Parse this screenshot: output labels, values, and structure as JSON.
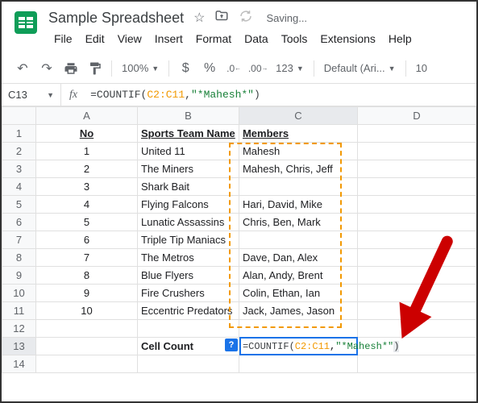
{
  "doc": {
    "title": "Sample Spreadsheet",
    "saving": "Saving..."
  },
  "menu": {
    "file": "File",
    "edit": "Edit",
    "view": "View",
    "insert": "Insert",
    "format": "Format",
    "data": "Data",
    "tools": "Tools",
    "extensions": "Extensions",
    "help": "Help"
  },
  "toolbar": {
    "zoom": "100%",
    "numfmt": "123",
    "font": "Default (Ari...",
    "fontsize": "10"
  },
  "cellref": "C13",
  "formula": {
    "fn": "=COUNTIF",
    "open": "(",
    "range": "C2:C11",
    "comma": ",",
    "str": "\"*Mahesh*\"",
    "close": ")"
  },
  "cols": {
    "A": "A",
    "B": "B",
    "C": "C",
    "D": "D"
  },
  "rows": [
    "1",
    "2",
    "3",
    "4",
    "5",
    "6",
    "7",
    "8",
    "9",
    "10",
    "11",
    "12",
    "13",
    "14"
  ],
  "headers": {
    "no": "No",
    "team": "Sports Team Name",
    "members": "Members"
  },
  "data": [
    {
      "n": "1",
      "team": "United 11",
      "members": "Mahesh"
    },
    {
      "n": "2",
      "team": "The Miners",
      "members": "Mahesh, Chris, Jeff"
    },
    {
      "n": "3",
      "team": "Shark Bait",
      "members": ""
    },
    {
      "n": "4",
      "team": "Flying Falcons",
      "members": "Hari, David, Mike"
    },
    {
      "n": "5",
      "team": "Lunatic Assassins",
      "members": "Chris, Ben, Mark"
    },
    {
      "n": "6",
      "team": "Triple Tip Maniacs",
      "members": ""
    },
    {
      "n": "7",
      "team": "The Metros",
      "members": "Dave, Dan, Alex"
    },
    {
      "n": "8",
      "team": "Blue Flyers",
      "members": "Alan, Andy, Brent"
    },
    {
      "n": "9",
      "team": "Fire Crushers",
      "members": "Colin, Ethan, Ian"
    },
    {
      "n": "10",
      "team": "Eccentric Predators",
      "members": "Jack, James, Jason"
    }
  ],
  "cellcount_label": "Cell Count",
  "help": "?"
}
